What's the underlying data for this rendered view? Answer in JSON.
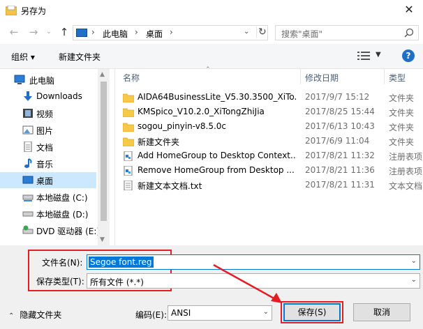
{
  "window": {
    "title": "另存为",
    "close_glyph": "✕"
  },
  "address": {
    "crumbs": [
      "此电脑",
      "桌面"
    ],
    "search_placeholder": "搜索\"桌面\""
  },
  "toolbar": {
    "organize": "组织 ▾",
    "new_folder": "新建文件夹"
  },
  "nav": {
    "items": [
      {
        "label": "此电脑",
        "icon": "pc-icon"
      },
      {
        "label": "Downloads",
        "icon": "download-icon"
      },
      {
        "label": "视频",
        "icon": "video-icon"
      },
      {
        "label": "图片",
        "icon": "picture-icon"
      },
      {
        "label": "文档",
        "icon": "document-icon"
      },
      {
        "label": "音乐",
        "icon": "music-icon"
      },
      {
        "label": "桌面",
        "icon": "desktop-icon",
        "selected": true
      },
      {
        "label": "本地磁盘 (C:)",
        "icon": "drive-icon"
      },
      {
        "label": "本地磁盘 (D:)",
        "icon": "drive-icon"
      },
      {
        "label": "DVD 驱动器 (E:)",
        "icon": "dvd-icon"
      }
    ]
  },
  "columns": {
    "name": "名称",
    "date": "修改日期",
    "type": "类型"
  },
  "files": [
    {
      "name": "AIDA64BusinessLite_V5.30.3500_XiTo...",
      "date": "2017/9/7 15:12",
      "type": "文件夹",
      "icon": "folder-icon"
    },
    {
      "name": "KMSpico_V10.2.0_XiTongZhiJia",
      "date": "2017/8/25 15:44",
      "type": "文件夹",
      "icon": "folder-icon"
    },
    {
      "name": "sogou_pinyin-v8.5.0c",
      "date": "2017/6/13 10:43",
      "type": "文件夹",
      "icon": "folder-icon"
    },
    {
      "name": "新建文件夹",
      "date": "2017/6/9 11:04",
      "type": "文件夹",
      "icon": "folder-icon"
    },
    {
      "name": "Add HomeGroup to Desktop Context...",
      "date": "2017/8/21 11:32",
      "type": "注册表项",
      "icon": "registry-icon"
    },
    {
      "name": "Remove HomeGroup from Desktop ...",
      "date": "2017/8/21 11:36",
      "type": "注册表项",
      "icon": "registry-icon"
    },
    {
      "name": "新建文本文档.txt",
      "date": "2017/8/21 11:31",
      "type": "文本文档",
      "icon": "text-file-icon"
    }
  ],
  "form": {
    "filename_label": "文件名(N):",
    "filename_value": "Segoe font.reg",
    "type_label": "保存类型(T):",
    "type_value": "所有文件  (*.*)"
  },
  "footer": {
    "hide_folders": "隐藏文件夹",
    "encoding_label": "编码(E):",
    "encoding_value": "ANSI",
    "save": "保存(S)",
    "cancel": "取消"
  },
  "colors": {
    "accent": "#0078d7",
    "annotation": "#e51c23",
    "selection": "#cce8ff"
  }
}
